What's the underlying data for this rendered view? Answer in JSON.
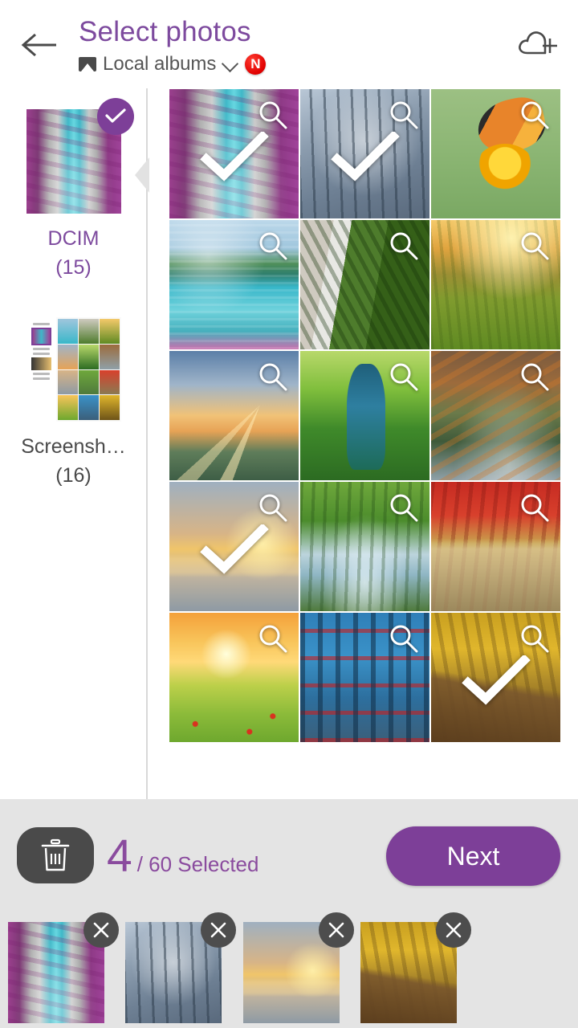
{
  "header": {
    "back_icon": "arrow-left-icon",
    "title": "Select photos",
    "source_icon": "album-icon",
    "source_label": "Local albums",
    "dropdown_icon": "chevron-down-icon",
    "badge_label": "N",
    "badge_color": "#e00000",
    "cloud_action_icon": "cloud-plus-icon",
    "title_color": "#7d4a9e"
  },
  "sidebar": {
    "albums": [
      {
        "name": "DCIM",
        "count": "(15)",
        "selected": true,
        "art": "sc-canyon",
        "check_icon": "check-icon"
      },
      {
        "name": "Screensh…",
        "count": "(16)",
        "selected": false,
        "art": "sc-screenshot"
      }
    ]
  },
  "grid": {
    "zoom_icon": "magnifier-icon",
    "check_icon": "check-icon",
    "photos": [
      {
        "art": "sc-canyon",
        "selected": true
      },
      {
        "art": "sc-winter",
        "selected": true
      },
      {
        "art": "sc-butterfly",
        "selected": false
      },
      {
        "art": "sc-lake",
        "selected": false
      },
      {
        "art": "sc-waterfall",
        "selected": false
      },
      {
        "art": "sc-hills",
        "selected": false
      },
      {
        "art": "sc-sunrays",
        "selected": false
      },
      {
        "art": "sc-peacock",
        "selected": false
      },
      {
        "art": "sc-autumncreek",
        "selected": false
      },
      {
        "art": "sc-pier",
        "selected": true
      },
      {
        "art": "sc-greencreek",
        "selected": false
      },
      {
        "art": "sc-redbridge",
        "selected": false
      },
      {
        "art": "sc-poppy",
        "selected": false
      },
      {
        "art": "sc-blueforest",
        "selected": false
      },
      {
        "art": "sc-goldbridge",
        "selected": true
      }
    ]
  },
  "bottom": {
    "delete_icon": "trash-icon",
    "selected_count": "4",
    "selected_total": "/ 60 Selected",
    "next_label": "Next",
    "next_color": "#7d3f98",
    "count_color": "#8a4b9e",
    "remove_icon": "close-icon",
    "selected_thumbs": [
      {
        "art": "sc-canyon"
      },
      {
        "art": "sc-winter"
      },
      {
        "art": "sc-pier"
      },
      {
        "art": "sc-goldbridge"
      }
    ]
  }
}
